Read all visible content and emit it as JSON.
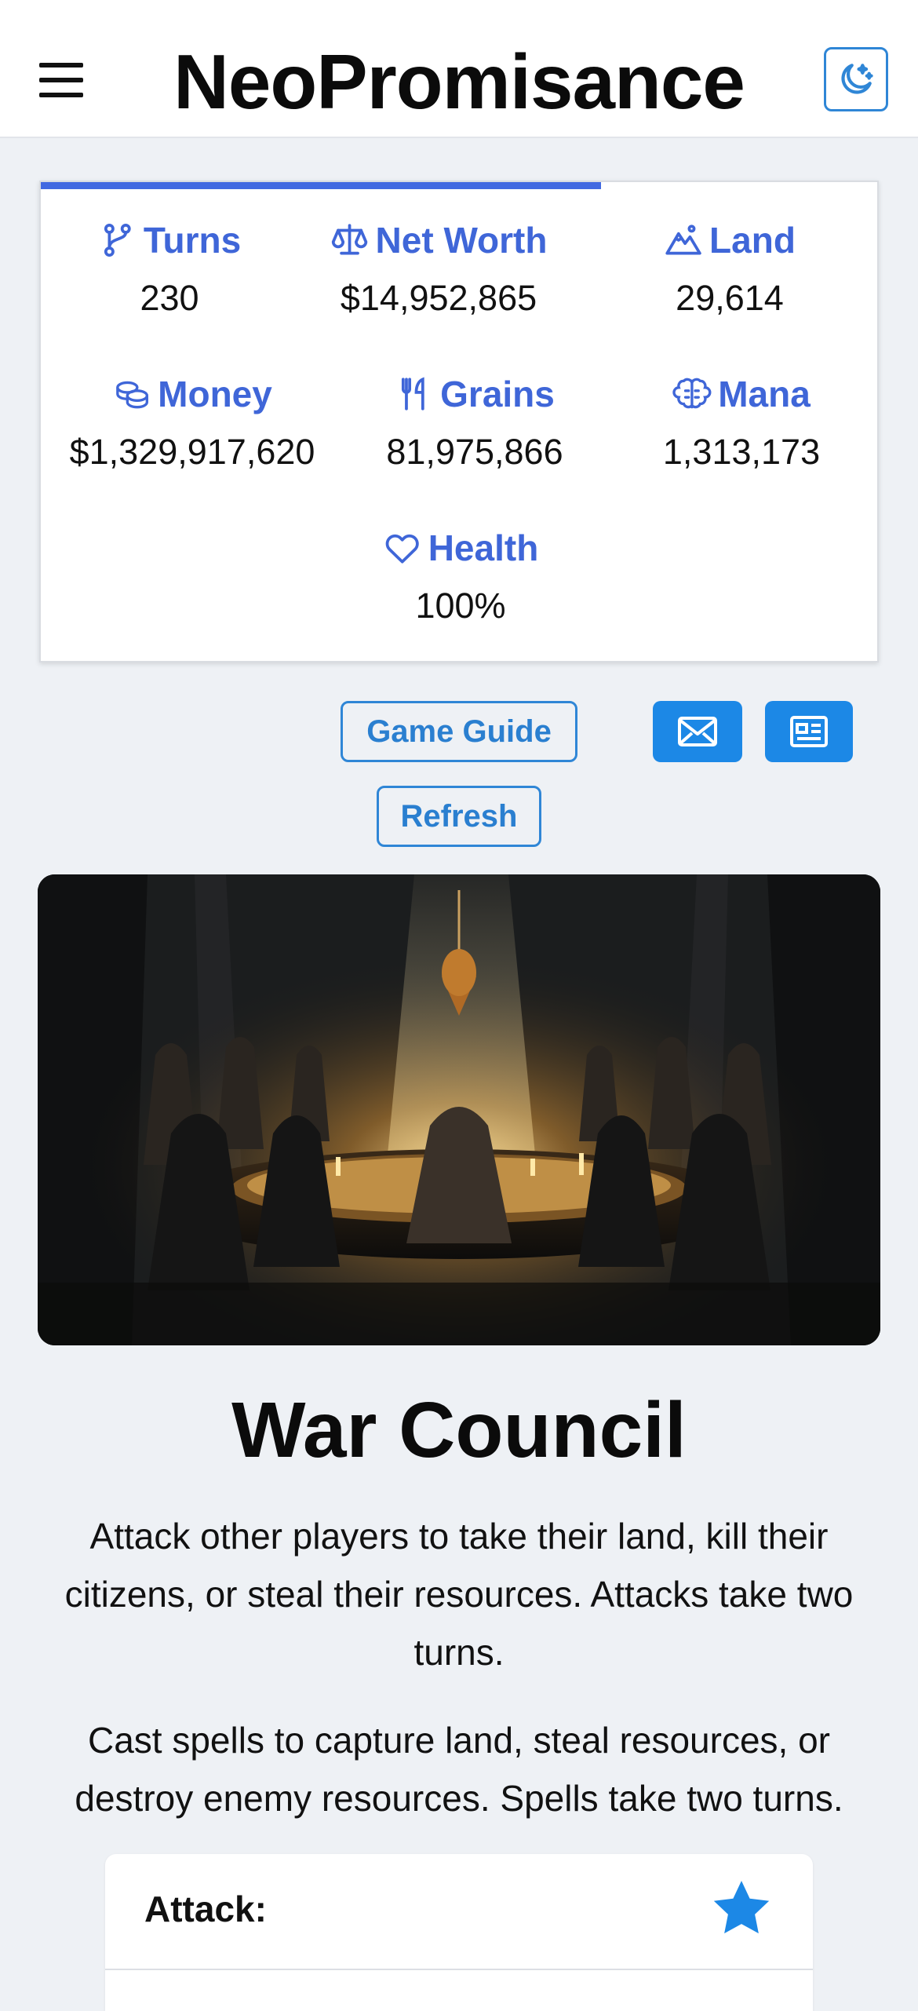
{
  "header": {
    "title": "NeoPromisance",
    "menu_icon": "hamburger-menu-icon",
    "theme_icon": "moon-star-icon"
  },
  "colors": {
    "accent": "#3f66d8",
    "button_blue": "#1c88e6",
    "outline_blue": "#2f86d6",
    "background": "#eef1f5"
  },
  "stats": {
    "progress_fraction": 0.67,
    "turns": {
      "label": "Turns",
      "value": "230",
      "icon": "branch-icon"
    },
    "net_worth": {
      "label": "Net Worth",
      "value": "$14,952,865",
      "icon": "scale-icon"
    },
    "land": {
      "label": "Land",
      "value": "29,614",
      "icon": "mountains-icon"
    },
    "money": {
      "label": "Money",
      "value": "$1,329,917,620",
      "icon": "coins-icon"
    },
    "grains": {
      "label": "Grains",
      "value": "81,975,866",
      "icon": "fork-knife-icon"
    },
    "mana": {
      "label": "Mana",
      "value": "1,313,173",
      "icon": "brain-icon"
    },
    "health": {
      "label": "Health",
      "value": "100%",
      "icon": "heart-icon"
    }
  },
  "actions": {
    "game_guide_label": "Game Guide",
    "refresh_label": "Refresh",
    "mail_icon": "envelope-icon",
    "news_icon": "newspaper-icon"
  },
  "page": {
    "title": "War Council",
    "paragraph_1": "Attack other players to take their land, kill their citizens, or steal their resources. Attacks take two turns.",
    "paragraph_2": "Cast spells to capture land, steal resources, or destroy enemy resources. Spells take two turns."
  },
  "attack_card": {
    "label": "Attack:",
    "favorite_icon": "star-icon"
  }
}
